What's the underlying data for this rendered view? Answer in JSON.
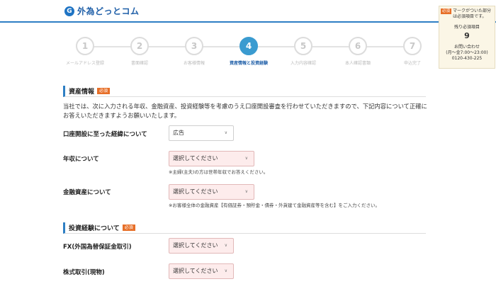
{
  "header": {
    "logo_mark": "G",
    "logo_text": "外為どっとコム"
  },
  "side": {
    "required_badge": "必須",
    "required_note": "マークがついた部分は必須項目です。",
    "remaining_label": "残り必須項目",
    "remaining_count": "9",
    "contact_label": "お問い合わせ",
    "contact_hours": "(月〜金7:00〜23:00)",
    "contact_phone": "0120-430-225"
  },
  "steps": [
    {
      "num": "1",
      "label": "メールアドレス登録"
    },
    {
      "num": "2",
      "label": "書面確認"
    },
    {
      "num": "3",
      "label": "お客様情報"
    },
    {
      "num": "4",
      "label": "資産情報と投資経験"
    },
    {
      "num": "5",
      "label": "入力内容確認"
    },
    {
      "num": "6",
      "label": "本人確認書類"
    },
    {
      "num": "7",
      "label": "申込完了"
    }
  ],
  "asset_section": {
    "title": "資産情報",
    "badge": "必須",
    "intro": "当社では、次に入力される年収、金融資産、投資経験等を考慮のうえ口座開設審査を行わせていただきますので、下記内容について正確にお答えいただきますようお願いいたします。",
    "fields": {
      "reason": {
        "label": "口座開設に至った経緯について",
        "value": "広告"
      },
      "income": {
        "label": "年収について",
        "value": "選択してください",
        "note": "※主婦(主夫)の方は世帯年収でお答えください。"
      },
      "assets": {
        "label": "金融資産について",
        "value": "選択してください",
        "note": "※お客様全体の金融資産【有価証券・預貯金・債券・外貨建て金融資産等を含む】をご入力ください。"
      }
    }
  },
  "experience_section": {
    "title": "投資経験について",
    "badge": "必須",
    "fields": {
      "fx": {
        "label": "FX(外国為替保証金取引)",
        "value": "選択してください"
      },
      "stock": {
        "label": "株式取引(現物)",
        "value": "選択してください"
      }
    }
  }
}
